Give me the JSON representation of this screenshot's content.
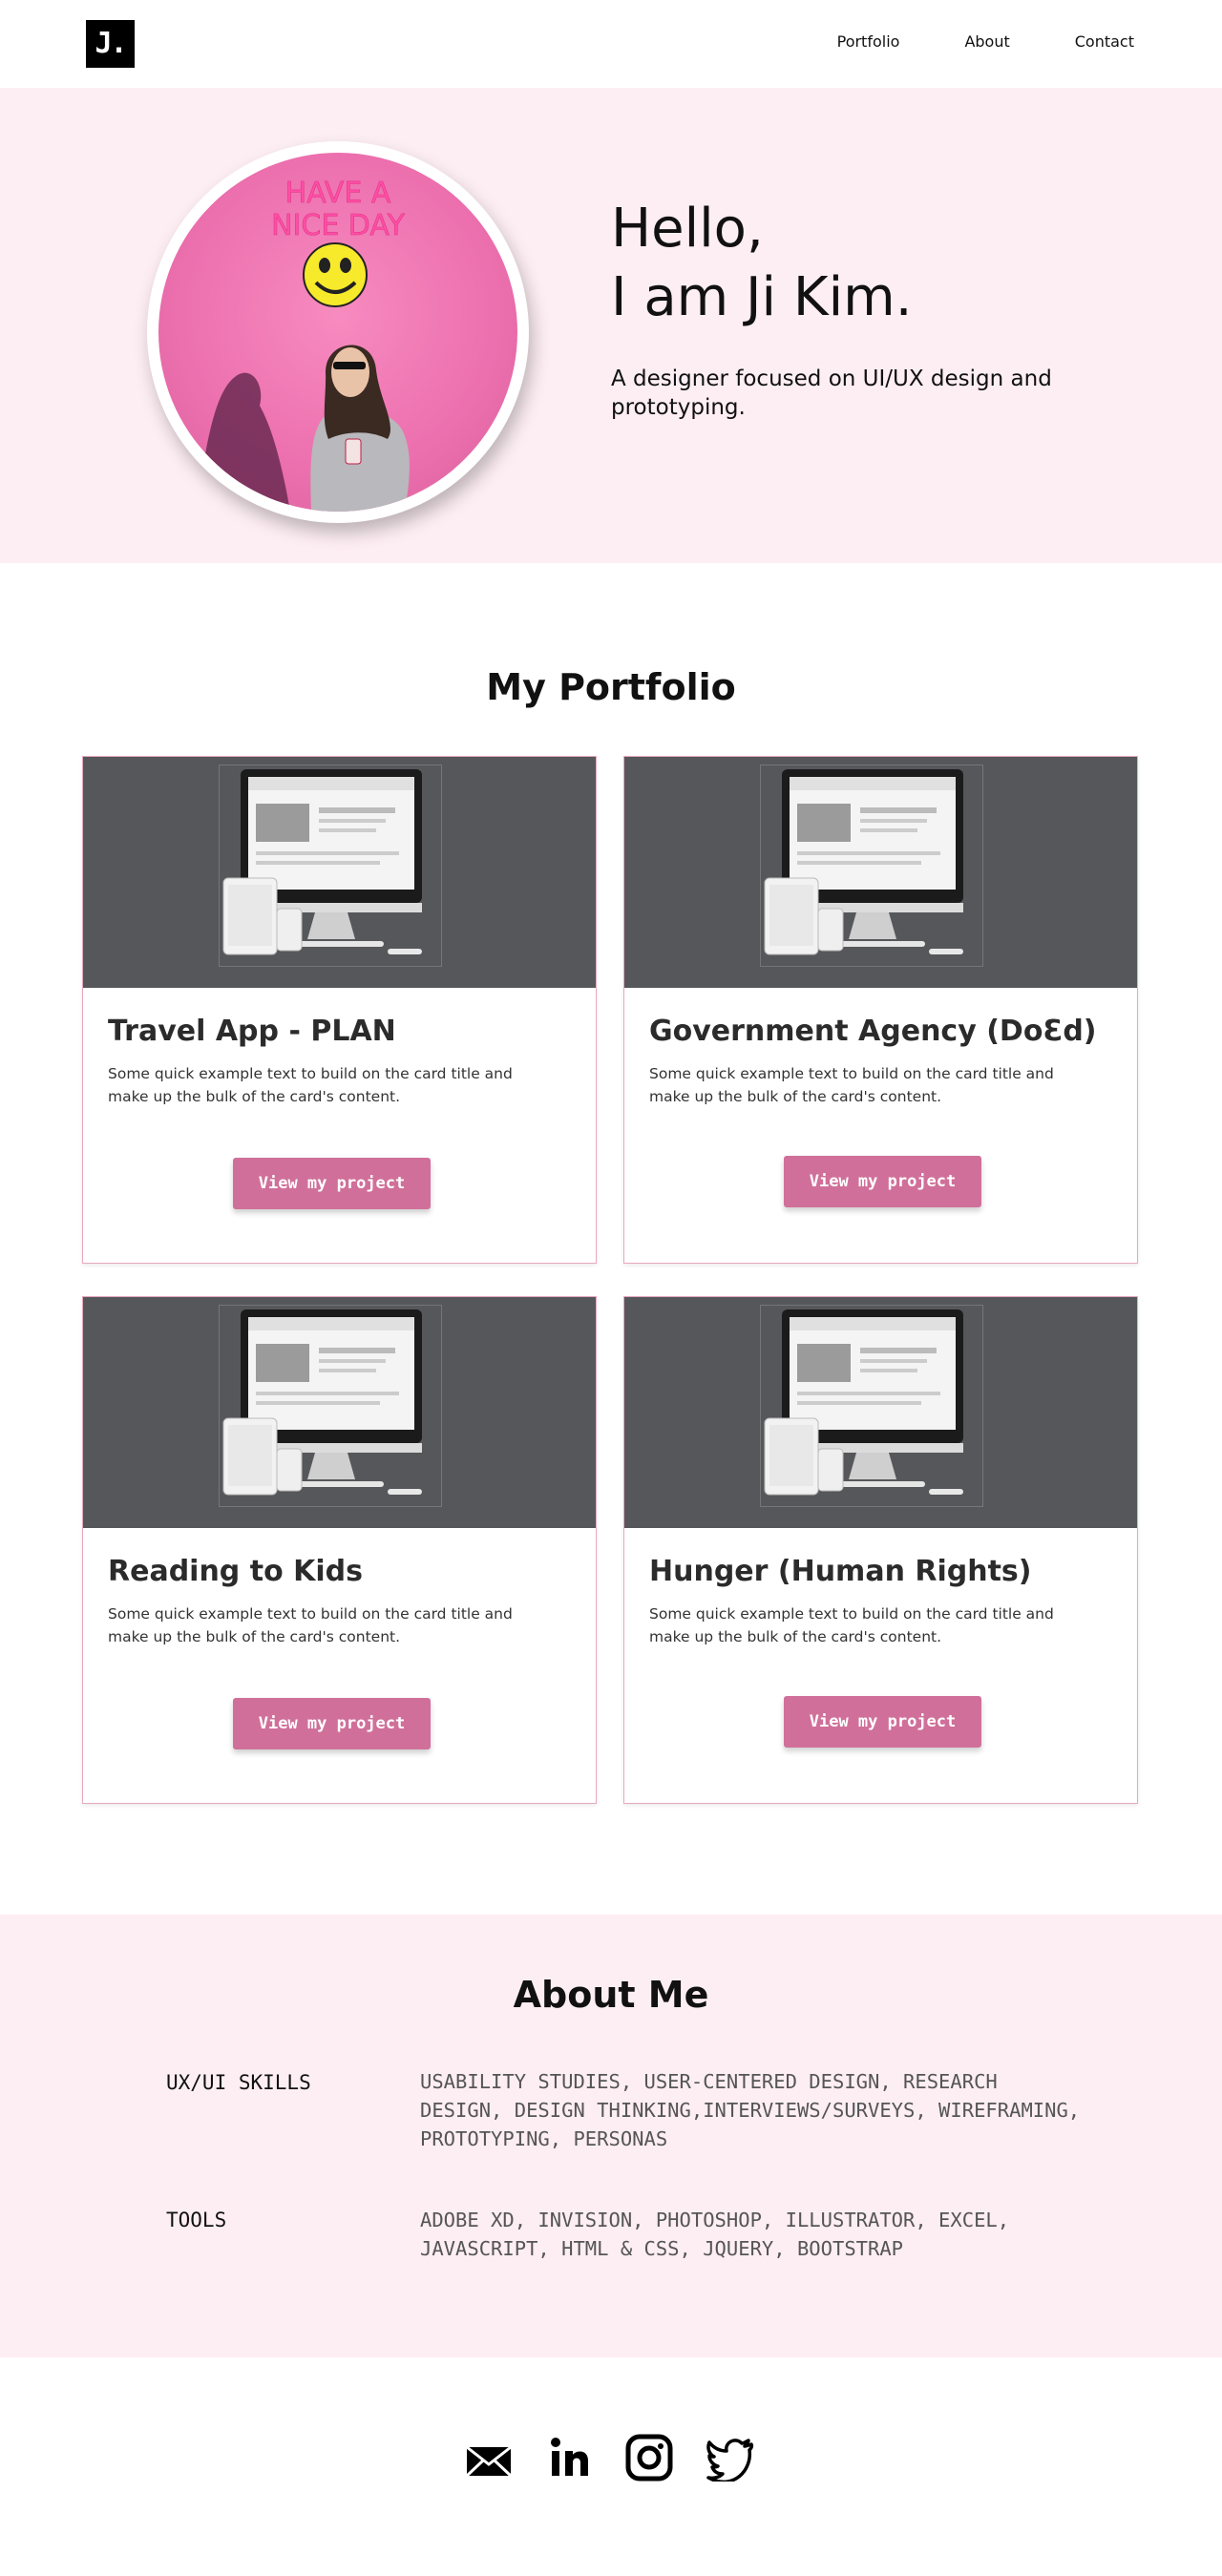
{
  "nav": {
    "logo": "J.",
    "links": [
      "Portfolio",
      "About",
      "Contact"
    ]
  },
  "hero": {
    "greeting_line1": "Hello,",
    "greeting_line2": "I am Ji Kim.",
    "subtitle": "A designer focused on UI/UX design and prototyping.",
    "photo_text_line1": "HAVE A",
    "photo_text_line2": "NICE DAY"
  },
  "portfolio": {
    "title": "My Portfolio",
    "cards": [
      {
        "title": "Travel App - PLAN",
        "text": "Some quick example text to build on the card title and make up the bulk of the card's content.",
        "button": "View my project"
      },
      {
        "title": "Government Agency (DoƐd)",
        "text": "Some quick example text to build on the card title and make up the bulk of the card's content.",
        "button": "View my project"
      },
      {
        "title": "Reading to Kids",
        "text": "Some quick example text to build on the card title and make up the bulk of the card's content.",
        "button": "View my project"
      },
      {
        "title": "Hunger (Human Rights)",
        "text": "Some quick example text to build on the card title and make up the bulk of the card's content.",
        "button": "View my project"
      }
    ]
  },
  "about": {
    "title": "About Me",
    "skills_label": "UX/UI SKILLS",
    "skills_value": "USABILITY STUDIES, USER-CENTERED DESIGN, RESEARCH DESIGN, DESIGN THINKING,INTERVIEWS/SURVEYS, WIREFRAMING, PROTOTYPING, PERSONAS",
    "tools_label": "TOOLS",
    "tools_value": "ADOBE XD, INVISION, PHOTOSHOP, ILLUSTRATOR, EXCEL, JAVASCRIPT, HTML & CSS, JQUERY, BOOTSTRAP"
  },
  "footer": {
    "icons": [
      "mail-icon",
      "linkedin-icon",
      "instagram-icon",
      "twitter-icon"
    ]
  },
  "colors": {
    "hero_bg": "#fdeef3",
    "accent_button": "#d0709a",
    "card_border": "#e6a9bf",
    "card_media_bg": "#56575a"
  }
}
